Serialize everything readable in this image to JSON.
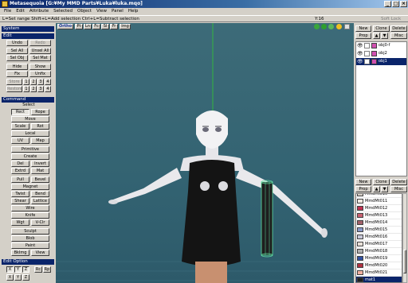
{
  "window": {
    "title": "Metasequoia [G:¥My MMD Parts¥Luka¥luka.mqo]",
    "controls": [
      "_",
      "□",
      "×"
    ]
  },
  "menu": [
    "File",
    "Edit",
    "Attribute",
    "Selected",
    "Object",
    "View",
    "Panel",
    "Help"
  ],
  "status": {
    "hint": "L=Set range  Shift+L=Add selection  Ctrl+L=Subtract selection",
    "value": "Y:16",
    "snap": "Soft Lock"
  },
  "left": {
    "system": "System",
    "edit": "Edit",
    "undo": "Undo",
    "redo": "Redo",
    "sel_all": "Sel All",
    "unsel_all": "Unsel All",
    "sel_obj": "Sel Obj",
    "sel_mat": "Sel Mat",
    "hide": "Hide",
    "show": "Show",
    "fix": "Fix",
    "unfix": "Unfix",
    "store": "Store",
    "restore": "Restore",
    "slots": [
      "1",
      "2",
      "3",
      "4"
    ],
    "command": "Command",
    "select": "Select",
    "rect": "Rect",
    "rope": "Rope",
    "move": "Move",
    "scale": "Scale",
    "rot": "Rot",
    "local": "Local",
    "uv": "UV",
    "map": "Map",
    "primitive": "Primitive",
    "create": "Create",
    "del": "Del",
    "invert": "Invert",
    "extrd": "Extrd",
    "mat": "Mat",
    "pull": "Pull",
    "bevel": "Bevel",
    "magnet": "Magnet",
    "twist": "Twist",
    "bend": "Bend",
    "shear": "Shear",
    "lattice": "Lattice",
    "wire": "Wire",
    "knife": "Knife",
    "wgt": "Wgt",
    "vcr": "V-Clr",
    "sculpt": "Sculpt",
    "blob": "Blob",
    "paint": "Paint",
    "bkimg": "BkImg",
    "view": "View",
    "edit_option": "Edit Option",
    "axes": [
      "X",
      "Y",
      "Z"
    ],
    "rc": "Rc",
    "rp": "Rp"
  },
  "viewtoolbar": [
    "Ortho",
    "Pt",
    "Ln",
    "Fc",
    "Sl",
    "Fr",
    "Img"
  ],
  "right": {
    "new": "New",
    "clone": "Clone",
    "delete": "Delete",
    "prop": "Prop",
    "misc": "Misc",
    "objects": [
      {
        "name": "obj0-f",
        "selected": false
      },
      {
        "name": "obj2",
        "selected": false
      },
      {
        "name": "obj1",
        "selected": true
      }
    ],
    "materials": [
      {
        "name": "MmdMt010",
        "color": "#d8d0c8",
        "selected": false
      },
      {
        "name": "MmdMt011",
        "color": "#f0e8e0",
        "selected": false
      },
      {
        "name": "MmdMt012",
        "color": "#c03050",
        "selected": false
      },
      {
        "name": "MmdMt013",
        "color": "#c86070",
        "selected": false
      },
      {
        "name": "MmdMt014",
        "color": "#a06068",
        "selected": false
      },
      {
        "name": "MmdMt015",
        "color": "#8898c8",
        "selected": false
      },
      {
        "name": "MmdMt016",
        "color": "#c8c8d8",
        "selected": false
      },
      {
        "name": "MmdMt017",
        "color": "#e8e0d8",
        "selected": false
      },
      {
        "name": "MmdMt018",
        "color": "#b0b0b0",
        "selected": false
      },
      {
        "name": "MmdMt019",
        "color": "#3050a0",
        "selected": false
      },
      {
        "name": "MmdMt020",
        "color": "#b03040",
        "selected": false
      },
      {
        "name": "MmdMt021",
        "color": "#f0b0a0",
        "selected": false
      },
      {
        "name": "mat1",
        "color": "#202020",
        "selected": true
      },
      {
        "name": "mat1",
        "color": "#e0e0e0",
        "selected": false
      }
    ]
  }
}
